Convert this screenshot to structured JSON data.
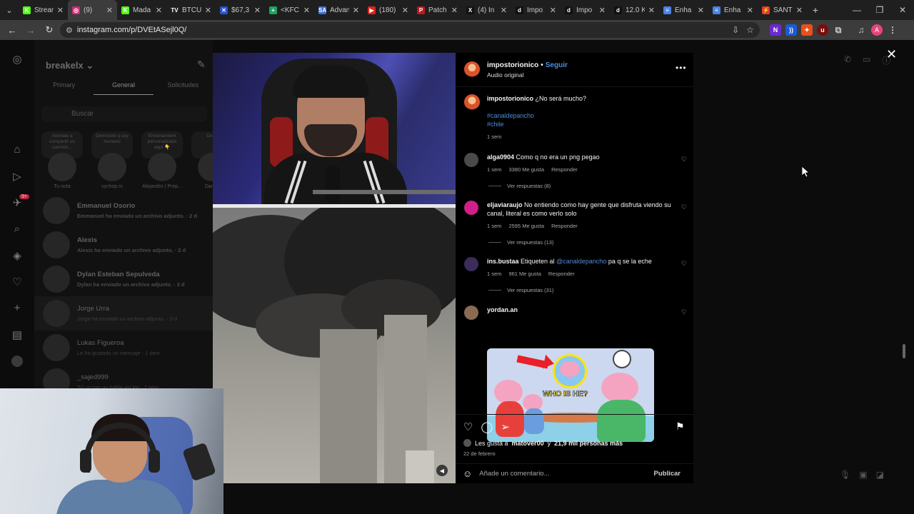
{
  "browser": {
    "tabs": [
      {
        "title": "Stream",
        "fav_color": "#53fc18",
        "fav_char": "K"
      },
      {
        "title": "(9)",
        "fav_color": "#d62976",
        "fav_char": "◎",
        "active": true
      },
      {
        "title": "Mada",
        "fav_color": "#53fc18",
        "fav_char": "K"
      },
      {
        "title": "BTCUS",
        "fav_color": "#222222",
        "fav_char": "TV"
      },
      {
        "title": "$67,3",
        "fav_color": "#2454d6",
        "fav_char": "✕"
      },
      {
        "title": "<KFC",
        "fav_color": "#1ea362",
        "fav_char": "+"
      },
      {
        "title": "Advan",
        "fav_color": "#3a6fd8",
        "fav_char": "SA"
      },
      {
        "title": "(180)",
        "fav_color": "#e62117",
        "fav_char": "▶"
      },
      {
        "title": "Patch",
        "fav_color": "#c0171f",
        "fav_char": "P"
      },
      {
        "title": "(4) In",
        "fav_color": "#111111",
        "fav_char": "X"
      },
      {
        "title": "Impo",
        "fav_color": "#111111",
        "fav_char": "d"
      },
      {
        "title": "Impo",
        "fav_color": "#111111",
        "fav_char": "d"
      },
      {
        "title": "12.0 K",
        "fav_color": "#111111",
        "fav_char": "d"
      },
      {
        "title": "Enha",
        "fav_color": "#4a82e8",
        "fav_char": "≡"
      },
      {
        "title": "Enha",
        "fav_color": "#4a82e8",
        "fav_char": "≡"
      },
      {
        "title": "SANT",
        "fav_color": "#e23b2e",
        "fav_char": "⚡"
      }
    ],
    "url": "instagram.com/p/DVEtASejl0Q/"
  },
  "dm": {
    "username": "breakelx",
    "tabs": [
      "Primary",
      "General",
      "Solicitudes"
    ],
    "search_placeholder": "Buscar",
    "notes": [
      {
        "bubble": "Animate a compartir un canción...",
        "name": "Tu nota"
      },
      {
        "bubble": "Demostré q soy humano",
        "name": "vychop.m"
      },
      {
        "bubble": "Entrenamient personalizado aquí 👇",
        "name": "Alejandro | Prep..."
      },
      {
        "bubble": "Doun",
        "name": "Dan G"
      }
    ],
    "conversations": [
      {
        "name": "Emmanuel Osorio",
        "msg": "Emmanuel ha enviado un archivo adjunto. · 2 d",
        "bold": true
      },
      {
        "name": "Alexis",
        "msg": "Alexis ha enviado un archivo adjunto. · 2 d",
        "bold": true
      },
      {
        "name": "Dylan Esteban Sepulveda",
        "msg": "Dylan ha enviado un archivo adjunto. · 3 d",
        "bold": true
      },
      {
        "name": "Jorge Urra",
        "msg": "Jorge ha enviado un archivo adjunto. · 3 d",
        "bold": false,
        "selected": true
      },
      {
        "name": "Lukas Figueroa",
        "msg": "Le ha gustado un mensaje · 1 sem",
        "bold": false
      },
      {
        "name": "_sajed999",
        "msg": "Tú: q csm pq habla asi klo · 1 sem",
        "bold": false
      }
    ],
    "badge": "9+"
  },
  "post": {
    "author": "impostorionico",
    "follow": "Seguir",
    "audio": "Audio original",
    "caption_user": "impostorionico",
    "caption_text": "¿No será mucho?",
    "hashtags": [
      "#canaldepancho",
      "#chile"
    ],
    "caption_time": "1 sem",
    "comments": [
      {
        "user": "alga0904",
        "text": "Como q no era un png pegao",
        "time": "1 sem",
        "likes": "3380 Me gusta",
        "reply": "Responder",
        "replies": "Ver respuestas (8)"
      },
      {
        "user": "eljaviaraujo",
        "text": "No entiendo como hay gente que disfruta viendo su canal, literal es como verlo solo",
        "time": "1 sem",
        "likes": "2595 Me gusta",
        "reply": "Responder",
        "replies": "Ver respuestas (13)"
      },
      {
        "user": "ins.bustaa",
        "text_before": "Etiqueten al",
        "mention": "@canaldepancho",
        "text_after": "pa q se la eche",
        "time": "1 sem",
        "likes": "961 Me gusta",
        "reply": "Responder",
        "replies": "Ver respuestas (31)"
      },
      {
        "user": "yordan.an",
        "gif_text": "WHO IS HE?"
      }
    ],
    "likes_prefix": "Les gusta a",
    "likes_user": "matover00",
    "likes_mid": "y",
    "likes_count": "21,9 mil personas más",
    "date": "22 de febrero",
    "add_comment_placeholder": "Añade un comentario...",
    "publish": "Publicar"
  }
}
